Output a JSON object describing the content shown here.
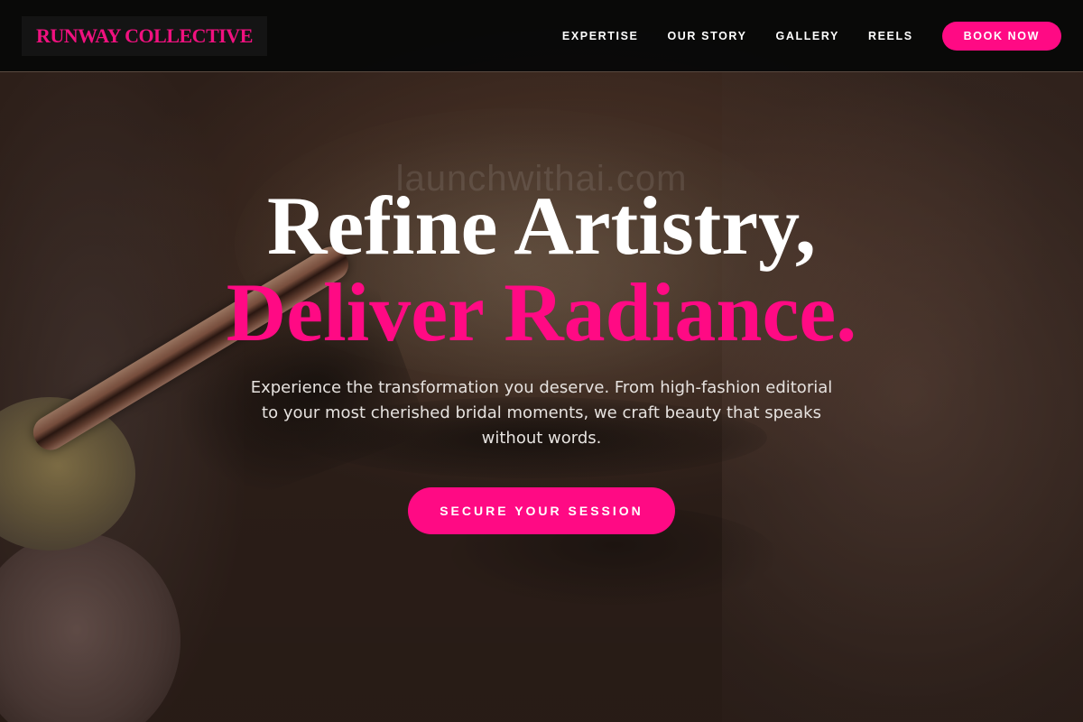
{
  "brand": {
    "logo_text": "RUNWAY COLLECTIVE",
    "accent_color": "#ff0a84"
  },
  "nav": {
    "items": [
      {
        "label": "EXPERTISE"
      },
      {
        "label": "OUR STORY"
      },
      {
        "label": "GALLERY"
      },
      {
        "label": "REELS"
      }
    ],
    "cta_label": "BOOK NOW"
  },
  "hero": {
    "headline_line1": "Refine Artistry,",
    "headline_line2": "Deliver Radiance.",
    "watermark": "launchwithai.com",
    "subtext": "Experience the transformation you deserve. From high-fashion editorial to your most cherished bridal moments, we craft beauty that speaks without words.",
    "cta_label": "SECURE YOUR SESSION",
    "background_image": "close-up eye makeup with brush"
  }
}
